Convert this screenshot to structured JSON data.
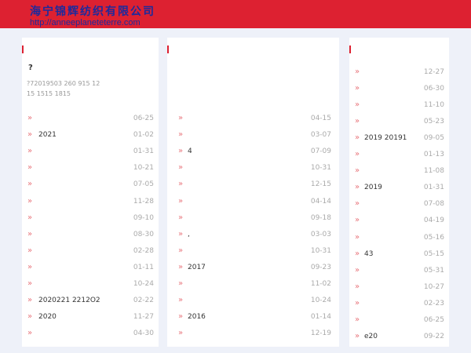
{
  "header": {
    "site_name": "海宁锦辉纺织有限公司",
    "url": "http://anneeplaneteterre.com"
  },
  "article": {
    "title": "?",
    "meta_line1": "?72019503  260 915 12",
    "meta_line2": "15 1515 1815"
  },
  "columns": [
    {
      "items": [
        {
          "title": "",
          "date": "06-25"
        },
        {
          "title": "2021",
          "date": "01-02"
        },
        {
          "title": "",
          "date": "01-31"
        },
        {
          "title": "",
          "date": "10-21"
        },
        {
          "title": "",
          "date": "07-05"
        },
        {
          "title": "",
          "date": "11-28"
        },
        {
          "title": "",
          "date": "09-10"
        },
        {
          "title": "",
          "date": "08-30"
        },
        {
          "title": "",
          "date": "02-28"
        },
        {
          "title": "",
          "date": "01-11"
        },
        {
          "title": "",
          "date": "10-24"
        },
        {
          "title": "2020221 2212O2",
          "date": "02-22"
        },
        {
          "title": "2020",
          "date": "11-27"
        },
        {
          "title": "",
          "date": "04-30"
        }
      ]
    },
    {
      "items": [
        {
          "title": "",
          "date": "04-15"
        },
        {
          "title": "",
          "date": "03-07"
        },
        {
          "title": "4",
          "date": "07-09"
        },
        {
          "title": "",
          "date": "10-31"
        },
        {
          "title": "",
          "date": "12-15"
        },
        {
          "title": "",
          "date": "04-14"
        },
        {
          "title": "",
          "date": "09-18"
        },
        {
          "title": ",",
          "date": "03-03"
        },
        {
          "title": "",
          "date": "10-31"
        },
        {
          "title": "2017",
          "date": "09-23"
        },
        {
          "title": "",
          "date": "11-02"
        },
        {
          "title": "",
          "date": "10-24"
        },
        {
          "title": "2016",
          "date": "01-14"
        },
        {
          "title": "",
          "date": "12-19"
        }
      ]
    },
    {
      "items": [
        {
          "title": "",
          "date": "12-27"
        },
        {
          "title": "",
          "date": "06-30"
        },
        {
          "title": "",
          "date": "11-10"
        },
        {
          "title": "",
          "date": "05-23"
        },
        {
          "title": "2019 20191",
          "date": "09-05"
        },
        {
          "title": "",
          "date": "01-13"
        },
        {
          "title": "",
          "date": "11-08"
        },
        {
          "title": "2019",
          "date": "01-31"
        },
        {
          "title": "",
          "date": "07-08"
        },
        {
          "title": "",
          "date": "04-19"
        },
        {
          "title": "",
          "date": "05-16"
        },
        {
          "title": "43",
          "date": "05-15"
        },
        {
          "title": "",
          "date": "05-31"
        },
        {
          "title": "",
          "date": "10-27"
        },
        {
          "title": "",
          "date": "02-23"
        },
        {
          "title": "",
          "date": "06-25"
        },
        {
          "title": "e20",
          "date": "09-22"
        }
      ]
    }
  ],
  "glyphs": {
    "arrow": "»"
  },
  "colors": {
    "header_bg": "#dd2131",
    "logo": "#1d2a9c",
    "arrow": "#e8747b",
    "marker": "#dd2131"
  }
}
